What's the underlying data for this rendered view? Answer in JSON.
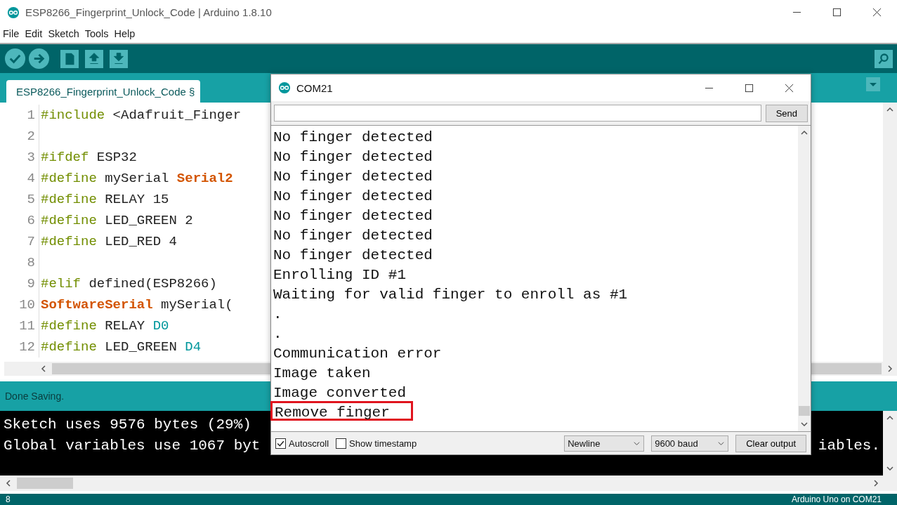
{
  "window": {
    "title": "ESP8266_Fingerprint_Unlock_Code | Arduino 1.8.10"
  },
  "menu": [
    {
      "label": "File"
    },
    {
      "label": "Edit"
    },
    {
      "label": "Sketch"
    },
    {
      "label": "Tools"
    },
    {
      "label": "Help"
    }
  ],
  "tabs": [
    {
      "label": "ESP8266_Fingerprint_Unlock_Code §",
      "selected": true
    }
  ],
  "editor": {
    "lines": [
      {
        "number": "1",
        "tokens": [
          {
            "text": "#include",
            "kind": "directive"
          },
          {
            "text": " <Adafruit_Finger",
            "kind": "plain"
          }
        ]
      },
      {
        "number": "2"
      },
      {
        "number": "3",
        "tokens": [
          {
            "text": "#ifdef",
            "kind": "directive"
          },
          {
            "text": " ESP32",
            "kind": "plain"
          }
        ]
      },
      {
        "number": "4",
        "tokens": [
          {
            "text": "#define",
            "kind": "directive"
          },
          {
            "text": " mySerial ",
            "kind": "plain"
          },
          {
            "text": "Serial2",
            "kind": "keyword"
          }
        ]
      },
      {
        "number": "5",
        "tokens": [
          {
            "text": "#define",
            "kind": "directive"
          },
          {
            "text": " RELAY 15",
            "kind": "plain"
          }
        ]
      },
      {
        "number": "6",
        "tokens": [
          {
            "text": "#define",
            "kind": "directive"
          },
          {
            "text": " LED_GREEN 2",
            "kind": "plain"
          }
        ]
      },
      {
        "number": "7",
        "tokens": [
          {
            "text": "#define",
            "kind": "directive"
          },
          {
            "text": " LED_RED 4",
            "kind": "plain"
          }
        ]
      },
      {
        "number": "8"
      },
      {
        "number": "9",
        "tokens": [
          {
            "text": "#elif",
            "kind": "directive"
          },
          {
            "text": " defined(ESP8266)",
            "kind": "plain"
          }
        ]
      },
      {
        "number": "10",
        "tokens": [
          {
            "text": "SoftwareSerial",
            "kind": "keyword"
          },
          {
            "text": " mySerial(",
            "kind": "plain"
          }
        ]
      },
      {
        "number": "11",
        "tokens": [
          {
            "text": "#define",
            "kind": "directive"
          },
          {
            "text": " RELAY ",
            "kind": "plain"
          },
          {
            "text": "D0",
            "kind": "constant"
          }
        ]
      },
      {
        "number": "12",
        "tokens": [
          {
            "text": "#define",
            "kind": "directive"
          },
          {
            "text": " LED_GREEN ",
            "kind": "plain"
          },
          {
            "text": "D4",
            "kind": "constant"
          }
        ]
      }
    ]
  },
  "console": {
    "status": "Done Saving.",
    "lines": [
      {
        "left": "Sketch uses 9576 bytes (29%)"
      },
      {
        "left": "Global variables use 1067 byt",
        "right": "iables."
      }
    ]
  },
  "status_bar": {
    "line": "8",
    "board": "Arduino Uno on COM21"
  },
  "serial_monitor": {
    "title": "COM21",
    "send": "Send",
    "output": [
      {
        "text": "No finger detected",
        "highlighted": false
      },
      {
        "text": "No finger detected",
        "highlighted": false
      },
      {
        "text": "No finger detected",
        "highlighted": false
      },
      {
        "text": "No finger detected",
        "highlighted": false
      },
      {
        "text": "No finger detected",
        "highlighted": false
      },
      {
        "text": "No finger detected",
        "highlighted": false
      },
      {
        "text": "No finger detected",
        "highlighted": false
      },
      {
        "text": "Enrolling ID #1",
        "highlighted": false
      },
      {
        "text": "Waiting for valid finger to enroll as #1",
        "highlighted": false
      },
      {
        "text": ".",
        "highlighted": false
      },
      {
        "text": ".",
        "highlighted": false
      },
      {
        "text": "Communication error",
        "highlighted": false
      },
      {
        "text": "Image taken",
        "highlighted": false
      },
      {
        "text": "Image converted",
        "highlighted": false
      },
      {
        "text": "Remove finger",
        "highlighted": true
      }
    ],
    "autoscroll": {
      "label": "Autoscroll",
      "checked": true
    },
    "timestamp": {
      "label": "Show timestamp",
      "checked": false
    },
    "line_ending": "Newline",
    "baud": "9600 baud",
    "clear": "Clear output"
  }
}
